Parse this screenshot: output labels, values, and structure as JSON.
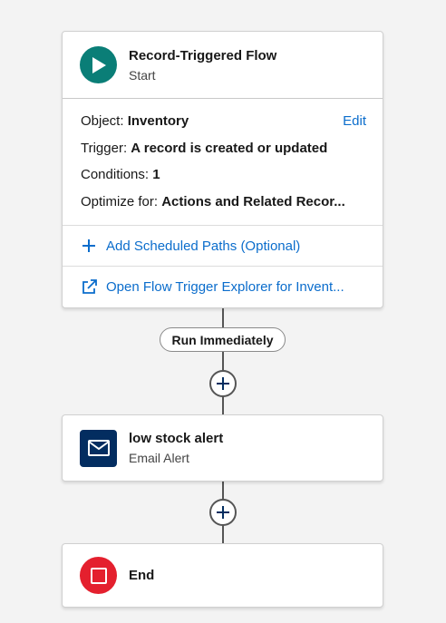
{
  "start": {
    "title": "Record-Triggered Flow",
    "subtitle": "Start",
    "details": {
      "object_label": "Object:",
      "object_value": "Inventory",
      "edit_label": "Edit",
      "trigger_label": "Trigger:",
      "trigger_value": "A record is created or updated",
      "conditions_label": "Conditions:",
      "conditions_value": "1",
      "optimize_label": "Optimize for:",
      "optimize_value": "Actions and Related Recor..."
    },
    "add_paths_label": "Add Scheduled Paths (Optional)",
    "open_explorer_label": "Open Flow Trigger Explorer for Invent..."
  },
  "path_label": "Run Immediately",
  "email_alert": {
    "title": "low stock alert",
    "subtitle": "Email Alert"
  },
  "end": {
    "title": "End"
  },
  "colors": {
    "start_icon": "#0a7e77",
    "email_icon": "#032d60",
    "end_icon": "#e4202e",
    "link": "#0b6dcc"
  },
  "icons": {
    "start": "play-icon",
    "email": "envelope-icon",
    "end": "stop-icon",
    "add": "plus-icon",
    "external": "external-link-icon"
  }
}
